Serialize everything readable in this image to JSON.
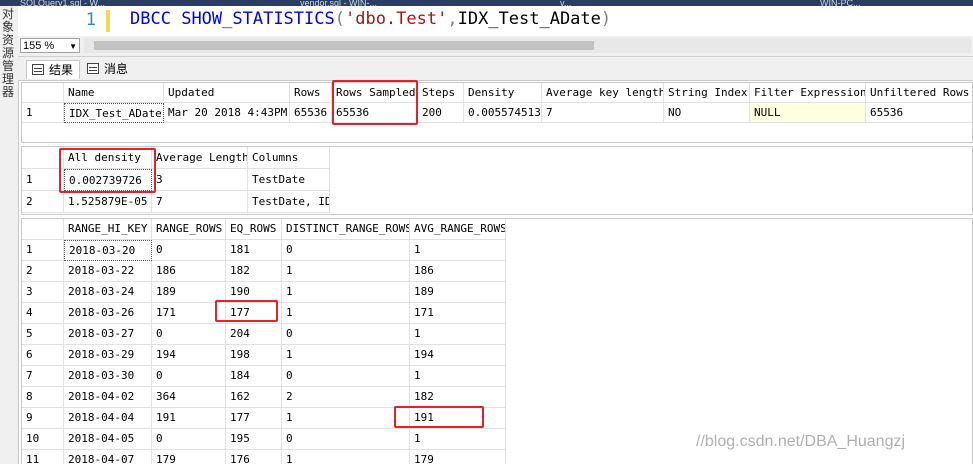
{
  "tabs": [
    "SQLQuery1.sql - W...",
    "vendor.sql - WIN-...",
    "v...",
    "WIN-PC..."
  ],
  "left_dock": {
    "label": "对象资源管理器"
  },
  "editor": {
    "line_number": "1",
    "code": {
      "kw1": "DBCC",
      "kw2": "SHOW_STATISTICS",
      "open": "(",
      "str": "'dbo.Test'",
      "comma": ",",
      "ident": "IDX_Test_ADate",
      "close": ")"
    }
  },
  "zoom": "155 %",
  "results_tabs": [
    "结果",
    "消息"
  ],
  "stat_header": {
    "columns": [
      "Name",
      "Updated",
      "Rows",
      "Rows Sampled",
      "Steps",
      "Density",
      "Average key length",
      "String Index",
      "Filter Expression",
      "Unfiltered Rows"
    ],
    "rows": [
      {
        "n": "1",
        "cells": [
          "IDX_Test_ADate",
          "Mar 20 2018  4:43PM",
          "65536",
          "65536",
          "200",
          "0.005574513",
          "7",
          "NO",
          "NULL",
          "65536"
        ]
      }
    ]
  },
  "density_vector": {
    "columns": [
      "All density",
      "Average Length",
      "Columns"
    ],
    "rows": [
      {
        "n": "1",
        "cells": [
          "0.002739726",
          "3",
          "TestDate"
        ]
      },
      {
        "n": "2",
        "cells": [
          "1.525879E-05",
          "7",
          "TestDate, ID"
        ]
      }
    ]
  },
  "histogram": {
    "columns": [
      "RANGE_HI_KEY",
      "RANGE_ROWS",
      "EQ_ROWS",
      "DISTINCT_RANGE_ROWS",
      "AVG_RANGE_ROWS"
    ],
    "rows": [
      {
        "n": "1",
        "cells": [
          "2018-03-20",
          "0",
          "181",
          "0",
          "1"
        ]
      },
      {
        "n": "2",
        "cells": [
          "2018-03-22",
          "186",
          "182",
          "1",
          "186"
        ]
      },
      {
        "n": "3",
        "cells": [
          "2018-03-24",
          "189",
          "190",
          "1",
          "189"
        ]
      },
      {
        "n": "4",
        "cells": [
          "2018-03-26",
          "171",
          "177",
          "1",
          "171"
        ]
      },
      {
        "n": "5",
        "cells": [
          "2018-03-27",
          "0",
          "204",
          "0",
          "1"
        ]
      },
      {
        "n": "6",
        "cells": [
          "2018-03-29",
          "194",
          "198",
          "1",
          "194"
        ]
      },
      {
        "n": "7",
        "cells": [
          "2018-03-30",
          "0",
          "184",
          "0",
          "1"
        ]
      },
      {
        "n": "8",
        "cells": [
          "2018-04-02",
          "364",
          "162",
          "2",
          "182"
        ]
      },
      {
        "n": "9",
        "cells": [
          "2018-04-04",
          "191",
          "177",
          "1",
          "191"
        ]
      },
      {
        "n": "10",
        "cells": [
          "2018-04-05",
          "0",
          "195",
          "0",
          "1"
        ]
      },
      {
        "n": "11",
        "cells": [
          "2018-04-07",
          "179",
          "176",
          "1",
          "179"
        ]
      }
    ]
  },
  "watermark": "//blog.csdn.net/DBA_Huangzj",
  "colors": {
    "keyword": "#0000ff",
    "string": "#a31515",
    "line_number": "#2b91af",
    "highlight_box": "#e8202a",
    "null_cell": "#ffffe1"
  }
}
